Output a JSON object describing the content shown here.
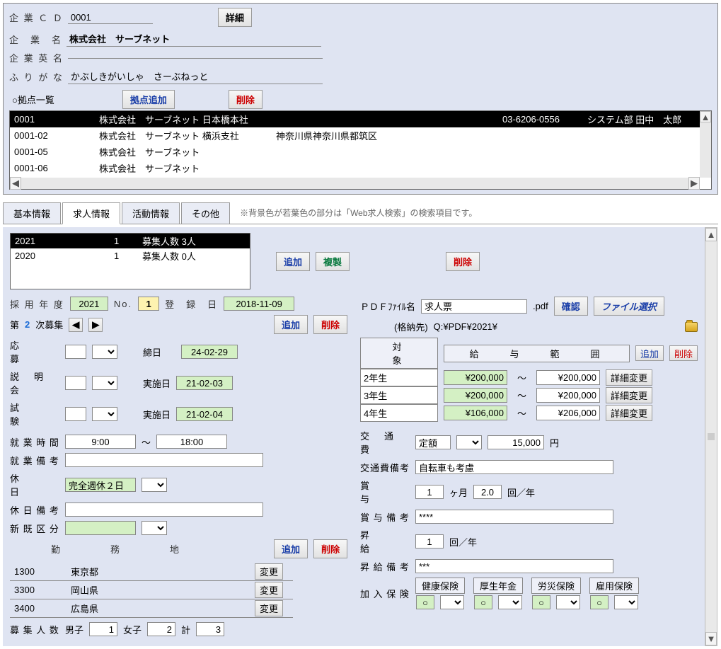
{
  "company": {
    "code_label": "企 業 Ｃ Ｄ",
    "code": "0001",
    "detail_btn": "詳細",
    "name_label": "企　業　名",
    "name": "株式会社　サーブネット",
    "en_label": "企 業 英 名",
    "en": "",
    "kana_label": "ふ り が な",
    "kana": "かぶしきがいしゃ　さーぶねっと"
  },
  "branch_section": {
    "title": "○拠点一覧",
    "add_btn": "拠点追加",
    "del_btn": "削除",
    "rows": [
      {
        "c0": "0001",
        "c1": "株式会社　サーブネット 日本橋本社",
        "c2": "",
        "c3": "03-6206-0556",
        "c4": "システム部 田中　太郎",
        "sel": true
      },
      {
        "c0": "0001-02",
        "c1": "株式会社　サーブネット 横浜支社",
        "c2": "神奈川県神奈川県都筑区",
        "c3": "",
        "c4": ""
      },
      {
        "c0": "0001-05",
        "c1": "株式会社　サーブネット",
        "c2": "",
        "c3": "",
        "c4": ""
      },
      {
        "c0": "0001-06",
        "c1": "株式会社　サーブネット",
        "c2": "",
        "c3": "",
        "c4": ""
      }
    ]
  },
  "tabs": {
    "t1": "基本情報",
    "t2": "求人情報",
    "t3": "活動情報",
    "t4": "その他",
    "note": "※背景色が若葉色の部分は「Web求人検索」の検索項目です。"
  },
  "posting_list": {
    "add": "追加",
    "dup": "複製",
    "del": "削除",
    "rows": [
      {
        "year": "2021",
        "no": "1",
        "count": "募集人数 3人",
        "sel": true
      },
      {
        "year": "2020",
        "no": "1",
        "count": "募集人数 0人"
      }
    ]
  },
  "posting": {
    "year_label": "採 用 年 度",
    "year": "2021",
    "no_label": "No.",
    "no": "1",
    "regdate_label": "登　録　日",
    "regdate": "2018-11-09",
    "rec_label_pre": "第",
    "rec_num": "2",
    "rec_label_post": "次募集",
    "prev": "◀",
    "next": "▶",
    "add": "追加",
    "del": "削除",
    "apply_label": "応　　　募",
    "deadline_label": "締日",
    "deadline": "24-02-29",
    "brief_label": "説　明　会",
    "brief_date_label": "実施日",
    "brief_date": "21-02-03",
    "exam_label": "試　　　験",
    "exam_date_label": "実施日",
    "exam_date": "21-02-04"
  },
  "pdf": {
    "name_label": "ＰＤＦﾌｧｲﾙ名",
    "name": "求人票",
    "ext": ".pdf",
    "confirm": "確認",
    "choose": "ファイル選択",
    "folder_label": "(格納先)",
    "folder": "Q:¥PDF¥2021¥"
  },
  "salary": {
    "target_h": "対　　　　象",
    "range_h": "給　　与　　範　　囲",
    "add": "追加",
    "del": "削除",
    "rows": [
      {
        "t": "2年生",
        "from": "¥200,000",
        "sep": "～",
        "to": "¥200,000",
        "btn": "詳細変更"
      },
      {
        "t": "3年生",
        "from": "¥200,000",
        "sep": "～",
        "to": "¥200,000",
        "btn": "詳細変更"
      },
      {
        "t": "4年生",
        "from": "¥106,000",
        "sep": "～",
        "to": "¥206,000",
        "btn": "詳細変更"
      }
    ]
  },
  "schedule": {
    "work_label": "就 業 時 間",
    "from": "9:00",
    "sep": "～",
    "to": "18:00",
    "note_label": "就 業 備 考",
    "note": "",
    "holiday_label": "休　　　　日",
    "holiday": "完全週休２日",
    "hnote_label": "休 日 備 考",
    "hnote": "",
    "newret_label": "新 既 区 分"
  },
  "loc": {
    "header": "勤　　　務　　　地",
    "add": "追加",
    "del": "削除",
    "change": "変更",
    "rows": [
      {
        "code": "1300",
        "name": "東京都"
      },
      {
        "code": "3300",
        "name": "岡山県"
      },
      {
        "code": "3400",
        "name": "広島県"
      }
    ]
  },
  "headcount": {
    "label": "募 集 人 数",
    "male_l": "男子",
    "male": "1",
    "female_l": "女子",
    "female": "2",
    "total_l": "計",
    "total": "3"
  },
  "trans": {
    "label": "交　通　費",
    "type": "定額",
    "amount": "15,000",
    "unit": "円",
    "note_l": "交通費備考",
    "note": "自転車も考慮"
  },
  "bonus": {
    "label": "賞　　　与",
    "months": "1",
    "months_unit": "ヶ月",
    "times": "2.0",
    "times_unit": "回／年",
    "note_l": "賞 与 備 考",
    "note": "****"
  },
  "raise": {
    "label": "昇　　　給",
    "times": "1",
    "unit": "回／年",
    "note_l": "昇 給 備 考",
    "note": "***"
  },
  "ins": {
    "label": "加 入 保 険",
    "items": [
      "健康保険",
      "厚生年金",
      "労災保険",
      "雇用保険"
    ],
    "val": "○"
  }
}
